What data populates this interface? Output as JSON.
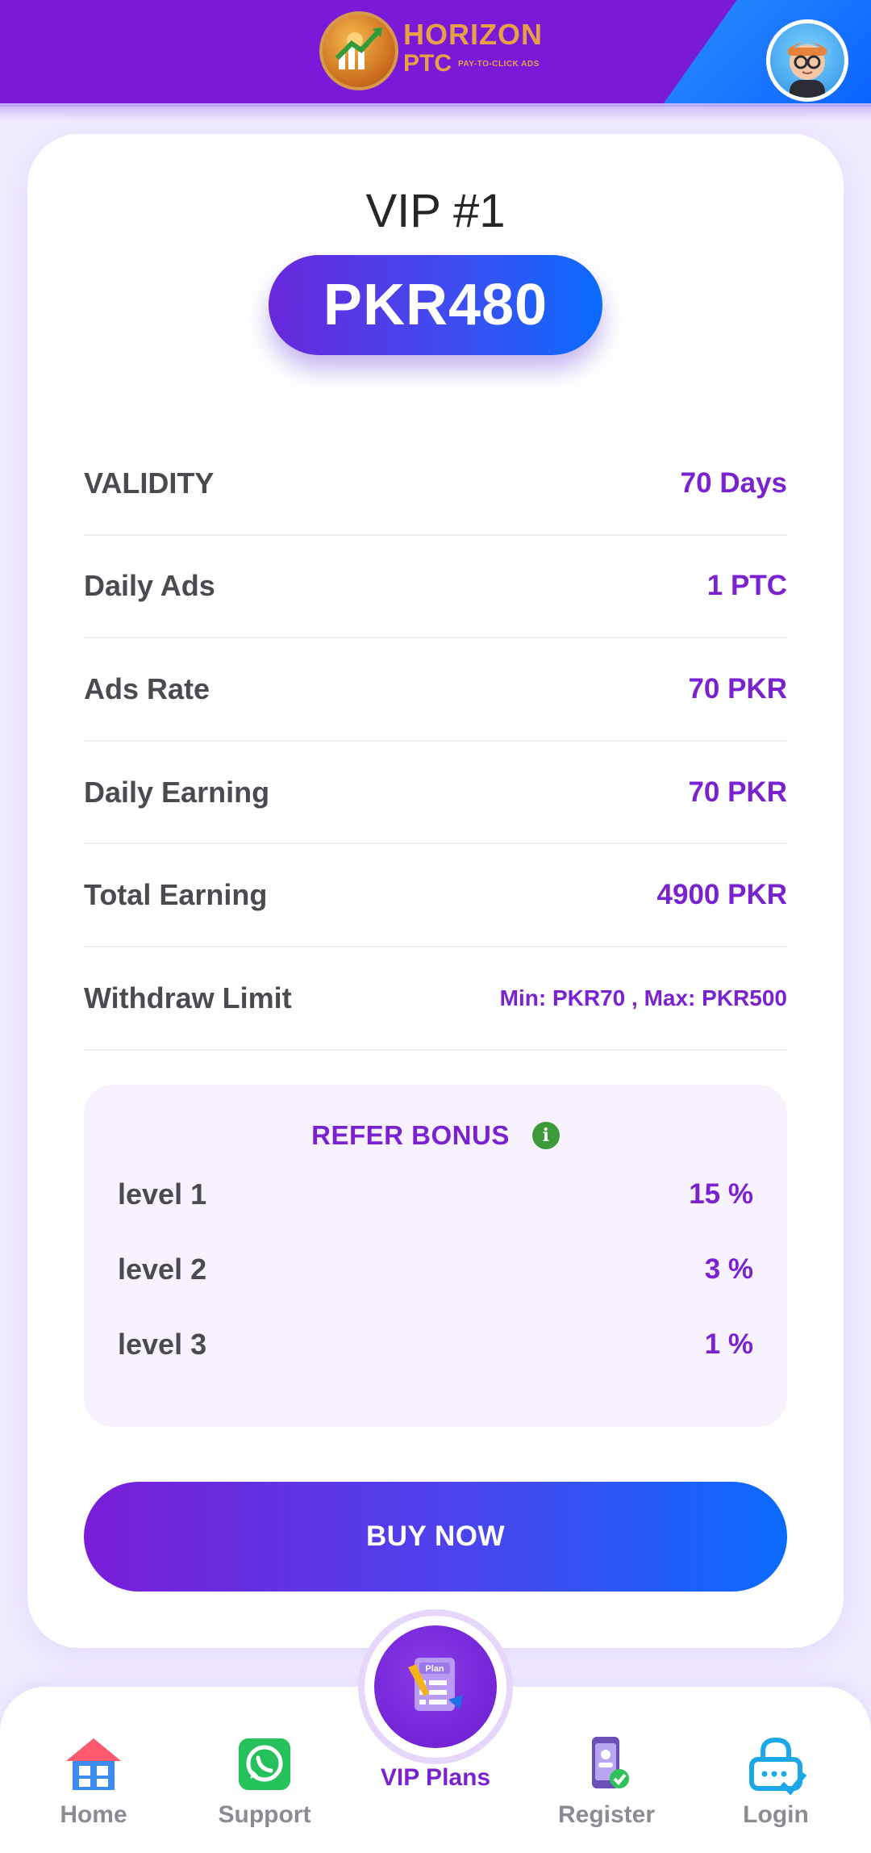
{
  "header": {
    "brand_name": "HORIZON",
    "brand_suffix": "PTC",
    "brand_tagline": "PAY-TO-CLICK ADS",
    "colors": {
      "bar": "#7a1ad8",
      "corner": "#0b63ff",
      "logo_gold": "#e7a046"
    }
  },
  "plan": {
    "title": "VIP #1",
    "price": "PKR480",
    "rows": [
      {
        "label": "VALIDITY",
        "value": "70 Days"
      },
      {
        "label": "Daily Ads",
        "value": "1 PTC"
      },
      {
        "label": "Ads Rate",
        "value": "70 PKR"
      },
      {
        "label": "Daily Earning",
        "value": "70 PKR"
      },
      {
        "label": "Total Earning",
        "value": "4900 PKR"
      },
      {
        "label": "Withdraw Limit",
        "value": "Min: PKR70 , Max: PKR500"
      }
    ],
    "refer": {
      "title": "REFER BONUS",
      "info_icon": "info-icon",
      "levels": [
        {
          "label": "level 1",
          "value": "15 %"
        },
        {
          "label": "level 2",
          "value": "3 %"
        },
        {
          "label": "level 3",
          "value": "1 %"
        }
      ]
    },
    "buy_label": "BUY NOW"
  },
  "nav": {
    "home": {
      "label": "Home",
      "icon": "house-icon"
    },
    "support": {
      "label": "Support",
      "icon": "whatsapp-icon"
    },
    "vip": {
      "label": "VIP Plans",
      "icon": "plan-clipboard-icon",
      "badge_text": "Plan"
    },
    "register": {
      "label": "Register",
      "icon": "register-phone-icon"
    },
    "login": {
      "label": "Login",
      "icon": "lock-icon"
    }
  },
  "colors": {
    "accent_purple": "#7a22cf",
    "accent_blue": "#0a6bff",
    "text_dark": "#4a4a50",
    "whatsapp_green": "#25c15a",
    "info_green": "#3c9a3a"
  }
}
